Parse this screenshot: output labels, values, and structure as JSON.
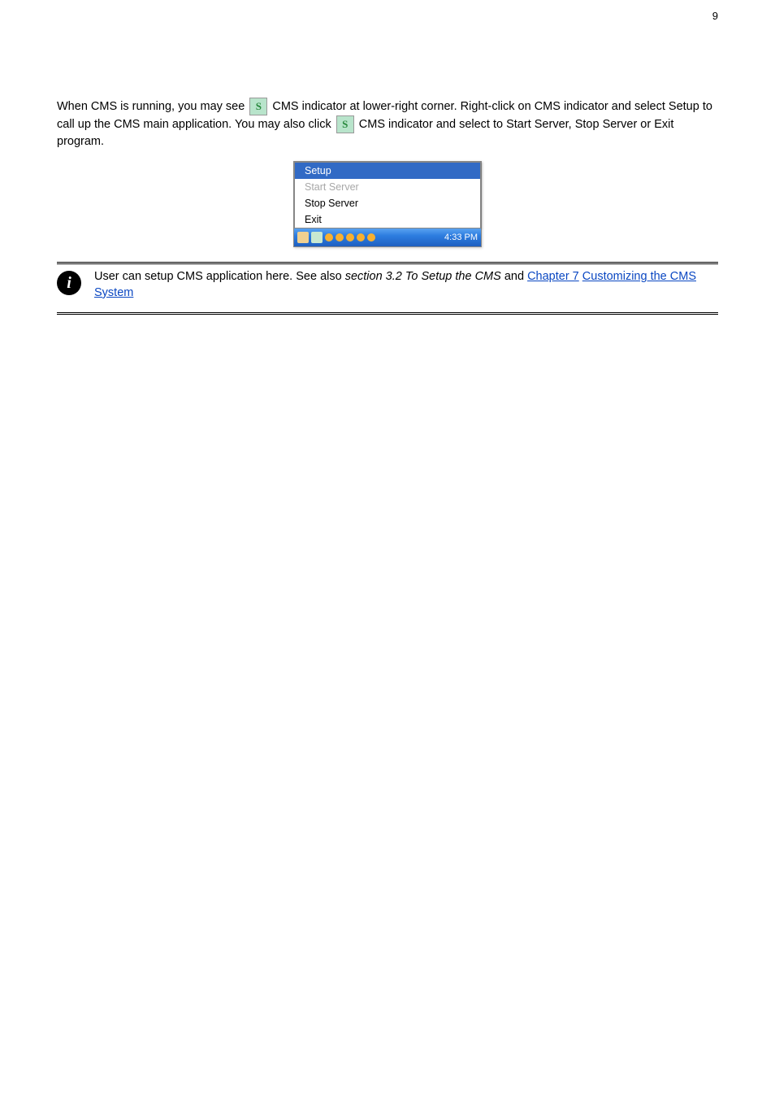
{
  "page_number_top": "9",
  "paragraph1_a": "When CMS is running, you may see ",
  "paragraph1_b": " CMS indicator at lower-right corner. Right-click on CMS indicator and select Setup to call up the CMS main application. You may also click ",
  "paragraph1_c": " CMS indicator and select to Start Server, Stop Server or Exit program.",
  "menu": {
    "items": [
      {
        "label": "Setup",
        "state": "selected"
      },
      {
        "label": "Start Server",
        "state": "disabled"
      },
      {
        "label": "Stop Server",
        "state": "enabled"
      },
      {
        "label": "Exit",
        "state": "enabled"
      }
    ],
    "clock": "4:33 PM"
  },
  "info_box": {
    "prefix": " User can setup CMS application here. See also ",
    "italic": "section 3.2 To Setup the CMS",
    "suffix": " and ",
    "link1": "Chapter 7",
    "link2": "Customizing the CMS System"
  }
}
